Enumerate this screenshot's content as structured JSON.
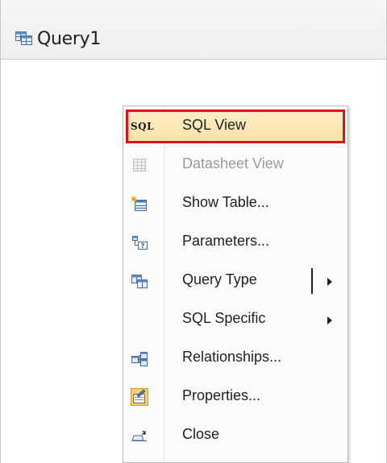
{
  "window": {
    "title": "Query1",
    "title_icon": "query-design-icon"
  },
  "context_menu": {
    "items": [
      {
        "label": "SQL View",
        "icon": "sql-icon",
        "glyph": "SQL",
        "state": "highlighted"
      },
      {
        "label": "Datasheet View",
        "icon": "datasheet-icon",
        "state": "disabled"
      },
      {
        "label": "Show Table...",
        "icon": "show-table-icon",
        "state": "enabled"
      },
      {
        "label": "Parameters...",
        "icon": "parameters-icon",
        "state": "enabled"
      },
      {
        "label": "Query Type",
        "icon": "query-type-icon",
        "state": "enabled",
        "submenu": true
      },
      {
        "label": "SQL Specific",
        "icon": "",
        "state": "enabled",
        "submenu": true
      },
      {
        "label": "Relationships...",
        "icon": "relationships-icon",
        "state": "enabled"
      },
      {
        "label": "Properties...",
        "icon": "properties-icon",
        "state": "enabled"
      },
      {
        "label": "Close",
        "icon": "close-icon",
        "state": "enabled"
      }
    ]
  },
  "colors": {
    "highlight_border": "#e0101a",
    "highlight_fill": "#fce2a5",
    "disabled_text": "#9a9a9a"
  }
}
